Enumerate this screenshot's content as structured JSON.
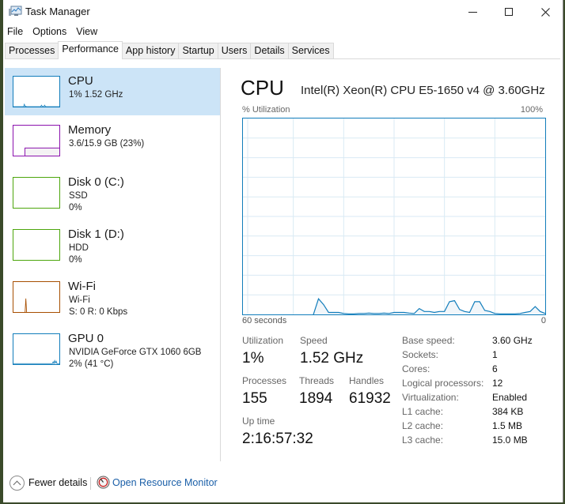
{
  "window": {
    "title": "Task Manager",
    "icon": "task-manager-icon",
    "controls": {
      "minimize": "—",
      "maximize": "☐",
      "close": "✕"
    }
  },
  "menu": [
    "File",
    "Options",
    "View"
  ],
  "tabs": [
    {
      "label": "Processes",
      "active": false
    },
    {
      "label": "Performance",
      "active": true
    },
    {
      "label": "App history",
      "active": false
    },
    {
      "label": "Startup",
      "active": false
    },
    {
      "label": "Users",
      "active": false
    },
    {
      "label": "Details",
      "active": false
    },
    {
      "label": "Services",
      "active": false
    }
  ],
  "sidebar": {
    "items": [
      {
        "title": "CPU",
        "lines": [
          "1% 1.52 GHz"
        ],
        "color": "#117dbb",
        "selected": true
      },
      {
        "title": "Memory",
        "lines": [
          "3.6/15.9 GB (23%)"
        ],
        "color": "#8b12ae",
        "selected": false
      },
      {
        "title": "Disk 0 (C:)",
        "lines": [
          "SSD",
          "0%"
        ],
        "color": "#4da60c",
        "selected": false
      },
      {
        "title": "Disk 1 (D:)",
        "lines": [
          "HDD",
          "0%"
        ],
        "color": "#4da60c",
        "selected": false
      },
      {
        "title": "Wi-Fi",
        "lines": [
          "Wi-Fi",
          "S: 0 R: 0 Kbps"
        ],
        "color": "#a74f01",
        "selected": false
      },
      {
        "title": "GPU 0",
        "lines": [
          "NVIDIA GeForce GTX 1060 6GB",
          "2% (41 °C)"
        ],
        "color": "#117dbb",
        "selected": false
      }
    ]
  },
  "main": {
    "title": "CPU",
    "processor_name": "Intel(R) Xeon(R) CPU E5-1650 v4 @ 3.60GHz",
    "graph_label": "% Utilization",
    "graph_max_label": "100%",
    "graph_time_label": "60 seconds",
    "graph_zero_label": "0",
    "stats": {
      "utilization": {
        "label": "Utilization",
        "value": "1%"
      },
      "speed": {
        "label": "Speed",
        "value": "1.52 GHz"
      },
      "processes": {
        "label": "Processes",
        "value": "155"
      },
      "threads": {
        "label": "Threads",
        "value": "1894"
      },
      "handles": {
        "label": "Handles",
        "value": "61932"
      },
      "uptime": {
        "label": "Up time",
        "value": "2:16:57:32"
      }
    },
    "details": [
      {
        "key": "Base speed:",
        "value": "3.60 GHz"
      },
      {
        "key": "Sockets:",
        "value": "1"
      },
      {
        "key": "Cores:",
        "value": "6"
      },
      {
        "key": "Logical processors:",
        "value": "12"
      },
      {
        "key": "Virtualization:",
        "value": "Enabled"
      },
      {
        "key": "L1 cache:",
        "value": "384 KB"
      },
      {
        "key": "L2 cache:",
        "value": "1.5 MB"
      },
      {
        "key": "L3 cache:",
        "value": "15.0 MB"
      }
    ]
  },
  "footer": {
    "fewer_details": "Fewer details",
    "open_resource_monitor": "Open Resource Monitor"
  },
  "chart_data": {
    "type": "area",
    "title": "% Utilization",
    "xlabel": "60 seconds",
    "x_range": [
      60,
      0
    ],
    "ylim": [
      0,
      100
    ],
    "grid": true,
    "color": "#117dbb",
    "fill": "#f1f6fa",
    "series": [
      {
        "name": "CPU",
        "start_index": 14,
        "values": [
          0,
          0,
          0,
          0,
          0,
          0,
          0,
          0,
          0,
          0,
          0,
          0,
          0,
          0,
          0,
          8,
          5,
          1,
          1,
          1,
          0.5,
          0.3,
          0.3,
          0.5,
          0.5,
          0.7,
          0.5,
          0.5,
          0.7,
          0.5,
          1,
          1,
          1,
          0.7,
          0.5,
          3,
          1.5,
          1.5,
          1,
          1.5,
          1.5,
          6.5,
          7,
          2.5,
          1.5,
          1,
          6.5,
          6.5,
          2,
          1.5,
          0.5,
          0.3,
          0.3,
          0.3,
          0.3,
          0.5,
          1,
          1.5,
          4,
          1.5,
          0.5
        ]
      }
    ],
    "thumbnails": {
      "cpu": [
        0,
        0,
        0,
        0,
        0,
        0,
        0,
        0,
        0,
        0,
        0,
        0,
        0,
        0,
        8,
        1,
        1,
        0,
        0,
        0,
        0,
        0,
        0,
        0,
        0,
        0,
        0,
        0,
        0,
        0,
        0,
        0,
        0,
        0,
        0,
        0,
        5,
        1,
        0,
        0,
        5,
        1,
        0,
        0,
        0,
        0,
        0,
        0,
        0,
        0,
        0,
        0,
        0,
        0,
        0,
        0,
        0,
        0,
        0,
        0
      ],
      "memory_fraction": 0.23,
      "memory_start_fraction": 0.25,
      "wifi": [
        0,
        0,
        0,
        0,
        0,
        0,
        0,
        0,
        0,
        0,
        0,
        0,
        0,
        0,
        0,
        0,
        0,
        0,
        0,
        0,
        0,
        0,
        0,
        0,
        0,
        0,
        0,
        0,
        0,
        0,
        0,
        0,
        0,
        0,
        0,
        0,
        0,
        0,
        0,
        0,
        0,
        0,
        0,
        0,
        0,
        0,
        0,
        0,
        0,
        0,
        0,
        0,
        0,
        0,
        0,
        0,
        0,
        0,
        0,
        0
      ],
      "wifi_spike_position": 0.27,
      "wifi_spike_value": 0.45,
      "gpu": [
        2,
        2,
        2,
        2,
        2,
        2,
        2,
        2,
        2,
        2,
        2,
        2,
        2,
        2,
        2,
        2,
        2,
        2,
        2,
        2,
        2,
        2,
        2,
        2,
        2,
        2,
        2,
        2,
        2,
        2,
        2,
        2,
        2,
        2,
        2,
        2,
        2,
        2,
        2,
        2,
        2,
        2,
        2,
        2,
        2,
        2,
        2,
        2,
        2,
        2,
        2,
        8,
        2,
        12,
        4,
        10,
        2,
        2,
        2,
        2
      ]
    }
  }
}
